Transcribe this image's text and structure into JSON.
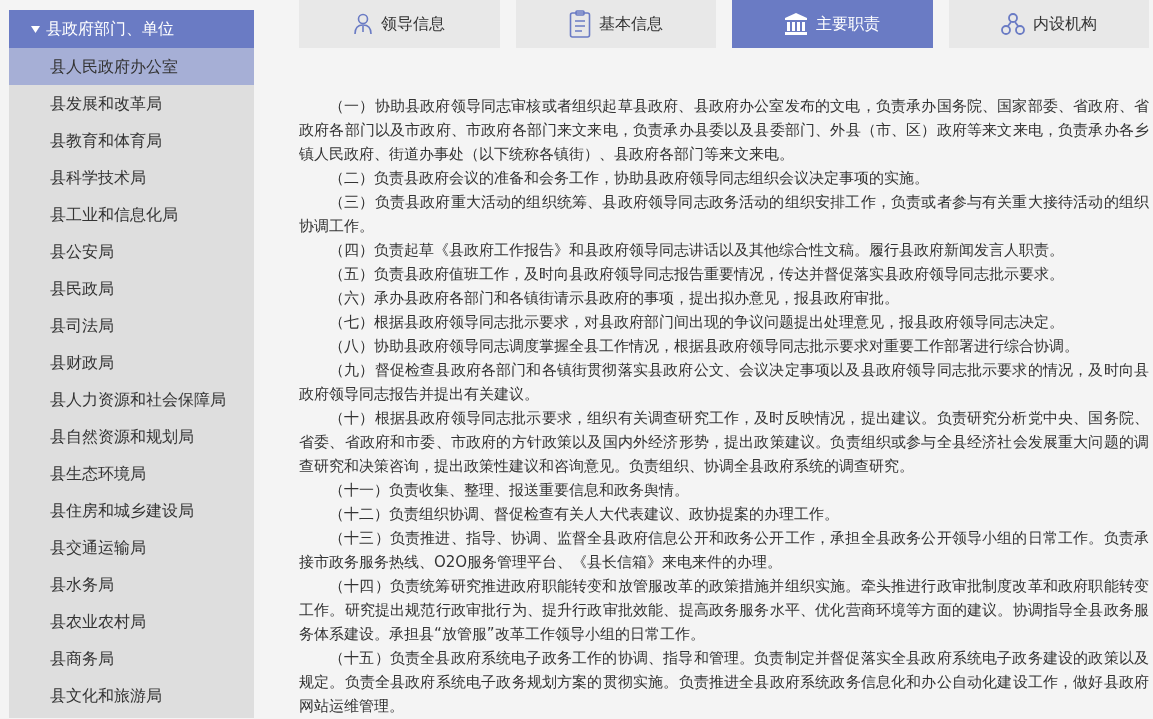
{
  "sidebar": {
    "group": {
      "label": "县政府部门、单位",
      "expanded": true
    },
    "items": [
      {
        "label": "县人民政府办公室",
        "selected": true
      },
      {
        "label": "县发展和改革局",
        "selected": false
      },
      {
        "label": "县教育和体育局",
        "selected": false
      },
      {
        "label": "县科学技术局",
        "selected": false
      },
      {
        "label": "县工业和信息化局",
        "selected": false
      },
      {
        "label": "县公安局",
        "selected": false
      },
      {
        "label": "县民政局",
        "selected": false
      },
      {
        "label": "县司法局",
        "selected": false
      },
      {
        "label": "县财政局",
        "selected": false
      },
      {
        "label": "县人力资源和社会保障局",
        "selected": false
      },
      {
        "label": "县自然资源和规划局",
        "selected": false
      },
      {
        "label": "县生态环境局",
        "selected": false
      },
      {
        "label": "县住房和城乡建设局",
        "selected": false
      },
      {
        "label": "县交通运输局",
        "selected": false
      },
      {
        "label": "县水务局",
        "selected": false
      },
      {
        "label": "县农业农村局",
        "selected": false
      },
      {
        "label": "县商务局",
        "selected": false
      },
      {
        "label": "县文化和旅游局",
        "selected": false
      }
    ]
  },
  "tabs": [
    {
      "label": "领导信息",
      "kind": "person",
      "selected": false
    },
    {
      "label": "基本信息",
      "kind": "clipboard",
      "selected": false
    },
    {
      "label": "主要职责",
      "kind": "building",
      "selected": true
    },
    {
      "label": "内设机构",
      "kind": "org",
      "selected": false
    }
  ],
  "paragraphs": [
    "（一）协助县政府领导同志审核或者组织起草县政府、县政府办公室发布的文电，负责承办国务院、国家部委、省政府、省政府各部门以及市政府、市政府各部门来文来电，负责承办县委以及县委部门、外县（市、区）政府等来文来电，负责承办各乡镇人民政府、街道办事处（以下统称各镇街）、县政府各部门等来文来电。",
    "（二）负责县政府会议的准备和会务工作，协助县政府领导同志组织会议决定事项的实施。",
    "（三）负责县政府重大活动的组织统筹、县政府领导同志政务活动的组织安排工作，负责或者参与有关重大接待活动的组织协调工作。",
    "（四）负责起草《县政府工作报告》和县政府领导同志讲话以及其他综合性文稿。履行县政府新闻发言人职责。",
    "（五）负责县政府值班工作，及时向县政府领导同志报告重要情况，传达并督促落实县政府领导同志批示要求。",
    "（六）承办县政府各部门和各镇街请示县政府的事项，提出拟办意见，报县政府审批。",
    "（七）根据县政府领导同志批示要求，对县政府部门间出现的争议问题提出处理意见，报县政府领导同志决定。",
    "（八）协助县政府领导同志调度掌握全县工作情况，根据县政府领导同志批示要求对重要工作部署进行综合协调。",
    "（九）督促检查县政府各部门和各镇街贯彻落实县政府公文、会议决定事项以及县政府领导同志批示要求的情况，及时向县政府领导同志报告并提出有关建议。",
    "（十）根据县政府领导同志批示要求，组织有关调查研究工作，及时反映情况，提出建议。负责研究分析党中央、国务院、省委、省政府和市委、市政府的方针政策以及国内外经济形势，提出政策建议。负责组织或参与全县经济社会发展重大问题的调查研究和决策咨询，提出政策性建议和咨询意见。负责组织、协调全县政府系统的调查研究。",
    "（十一）负责收集、整理、报送重要信息和政务舆情。",
    "（十二）负责组织协调、督促检查有关人大代表建议、政协提案的办理工作。",
    "（十三）负责推进、指导、协调、监督全县政府信息公开和政务公开工作，承担全县政务公开领导小组的日常工作。负责承接市政务服务热线、O2O服务管理平台、《县长信箱》来电来件的办理。",
    "（十四）负责统筹研究推进政府职能转变和放管服改革的政策措施并组织实施。牵头推进行政审批制度改革和政府职能转变工作。研究提出规范行政审批行为、提升行政审批效能、提高政务服务水平、优化营商环境等方面的建议。协调指导全县政务服务体系建设。承担县“放管服”改革工作领导小组的日常工作。",
    "（十五）负责全县政府系统电子政务工作的协调、指导和管理。负责制定并督促落实全县政府系统电子政务建设的政策以及规定。负责全县政府系统电子政务规划方案的贯彻实施。负责推进全县政府系统政务信息化和办公自动化建设工作，做好县政府网站运维管理。"
  ]
}
